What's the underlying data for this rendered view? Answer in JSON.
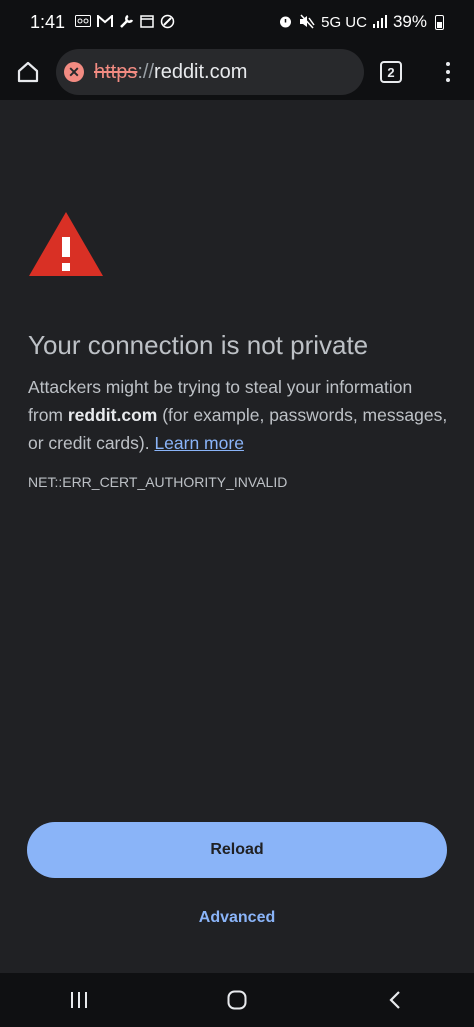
{
  "status_bar": {
    "time": "1:41",
    "network": "5G UC",
    "battery": "39%",
    "left_icons": [
      "voicemail-icon",
      "gmail-icon",
      "wrench-icon",
      "calendar-icon",
      "editor-icon"
    ],
    "right_icons": [
      "alarm-icon",
      "mute-icon",
      "signal-icon",
      "battery-icon"
    ]
  },
  "toolbar": {
    "url_scheme": "https",
    "url_separator": "://",
    "url_host": "reddit.com",
    "tab_count": "2"
  },
  "content": {
    "heading": "Your connection is not private",
    "body_intro": "Attackers might be trying to steal your information from ",
    "body_host": "reddit.com",
    "body_rest": " (for example, passwords, messages, or credit cards). ",
    "learn_more": "Learn more",
    "error_code": "NET::ERR_CERT_AUTHORITY_INVALID"
  },
  "actions": {
    "reload_label": "Reload",
    "advanced_label": "Advanced"
  },
  "colors": {
    "background": "#202124",
    "accent": "#8ab4f8",
    "danger": "#d93025"
  }
}
